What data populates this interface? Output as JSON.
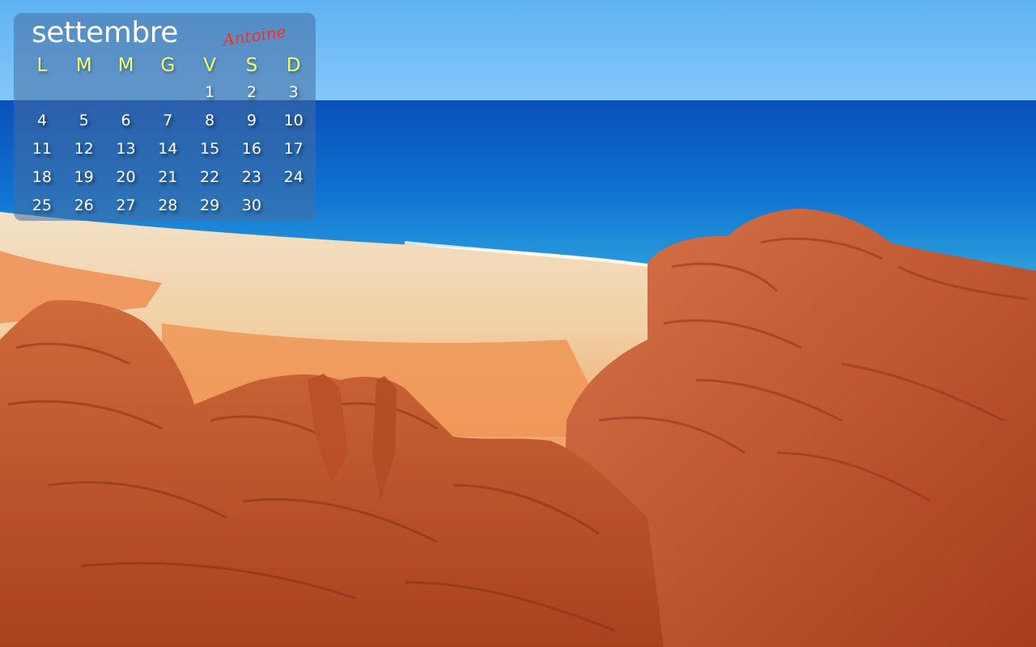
{
  "calendar": {
    "month": "settembre",
    "signature": "Antoine",
    "weekdays": [
      "L",
      "M",
      "M",
      "G",
      "V",
      "S",
      "D"
    ],
    "weeks": [
      [
        "",
        "",
        "",
        "",
        "1",
        "2",
        "3"
      ],
      [
        "4",
        "5",
        "6",
        "7",
        "8",
        "9",
        "10"
      ],
      [
        "11",
        "12",
        "13",
        "14",
        "15",
        "16",
        "17"
      ],
      [
        "18",
        "19",
        "20",
        "21",
        "22",
        "23",
        "24"
      ],
      [
        "25",
        "26",
        "27",
        "28",
        "29",
        "30",
        ""
      ]
    ]
  },
  "colors": {
    "sky": "#6ab8f5",
    "sea": "#0d6fd0",
    "sand": "#f3d9b5",
    "rock": "#c2552a",
    "weekday_text": "#f4ff6a"
  }
}
